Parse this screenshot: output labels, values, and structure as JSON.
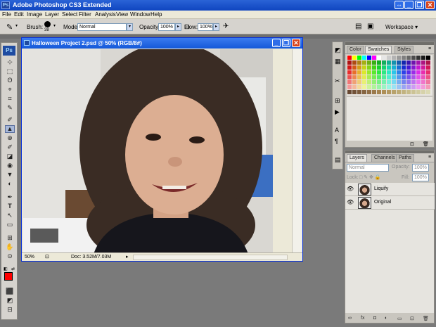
{
  "app": {
    "title": "Adobe Photoshop CS3 Extended",
    "logo": "Ps"
  },
  "window_controls": [
    "⇔",
    "_",
    "❐",
    "✕"
  ],
  "menu": [
    "File",
    "Edit",
    "Image",
    "Layer",
    "Select",
    "Filter",
    "Analysis",
    "View",
    "Window",
    "Help"
  ],
  "options": {
    "brush_label": "Brush:",
    "brush_size": "38",
    "mode_label": "Mode:",
    "mode_value": "Normal",
    "opacity_label": "Opacity:",
    "opacity_value": "100%",
    "flow_label": "Flow:",
    "flow_value": "100%",
    "workspace_label": "Workspace ▾"
  },
  "document": {
    "title": "Halloween Project 2.psd @ 50% (RGB/8#)",
    "zoom": "50%",
    "doc_info": "Doc: 3.52M/7.03M"
  },
  "tools": {
    "logo": "Ps",
    "items": [
      "⊹",
      "⬚",
      "ʘ",
      "⌖",
      "⌗",
      "✎",
      "✐",
      "▲",
      "⊕",
      "✐",
      "◪",
      "◉",
      "▼",
      "◐",
      "✒",
      "T",
      "↖",
      "▭",
      "⊞",
      "✋",
      "⊙",
      "⬛",
      "◩",
      "⊟"
    ]
  },
  "swatches_panel": {
    "tabs": [
      "Color",
      "Swatches",
      "Styles"
    ],
    "active_tab": "Swatches"
  },
  "layers_panel": {
    "tabs": [
      "Layers",
      "Channels",
      "Paths"
    ],
    "active_tab": "Layers",
    "blend_mode": "Normal",
    "opacity_label": "Opacity:",
    "opacity_value": "100%",
    "lock_label": "Lock:",
    "fill_label": "Fill:",
    "fill_value": "100%",
    "layers": [
      {
        "name": "Liquify",
        "visible": true
      },
      {
        "name": "Original",
        "visible": true
      }
    ]
  },
  "colors": {
    "foreground": "#ff0000",
    "background": "#ffffff",
    "titlebar": "#0f45c0"
  }
}
